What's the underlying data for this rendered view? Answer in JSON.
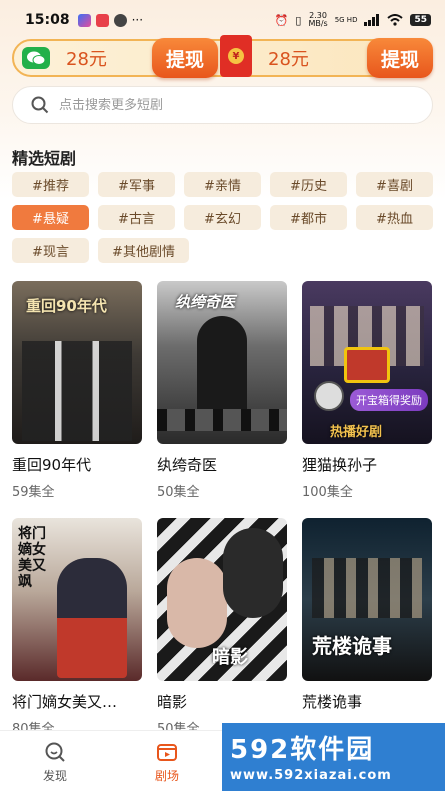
{
  "status_bar": {
    "time": "15:08",
    "speed_value": "2.30",
    "speed_unit": "MB/s",
    "network": "5G HD",
    "battery": "55"
  },
  "reward": {
    "left_amount": "28元",
    "right_amount": "28元",
    "withdraw_label": "提现",
    "redpacket_symbol": "¥"
  },
  "search": {
    "placeholder": "点击搜索更多短剧"
  },
  "section_title": "精选短剧",
  "tags": [
    "#推荐",
    "#军事",
    "#亲情",
    "#历史",
    "#喜剧",
    "#悬疑",
    "#古言",
    "#玄幻",
    "#都市",
    "#热血",
    "#现言",
    "#其他剧情"
  ],
  "active_tag_index": 5,
  "dramas": [
    {
      "title": "重回90年代",
      "episodes": "59集全",
      "poster_text": "重回90年代"
    },
    {
      "title": "纨绔奇医",
      "episodes": "50集全",
      "poster_text": "纨绔奇医"
    },
    {
      "title": "狸猫换孙子",
      "episodes": "100集全",
      "poster_text": "热播好剧",
      "badge": "开宝箱得奖励"
    },
    {
      "title": "将门嫡女美又…",
      "episodes": "80集全",
      "poster_text": "将门嫡女美又飒"
    },
    {
      "title": "暗影",
      "episodes": "50集全",
      "poster_text": "暗影"
    },
    {
      "title": "荒楼诡事",
      "episodes": "",
      "poster_text": "荒楼诡事"
    }
  ],
  "nav": {
    "discover": "发现",
    "theater": "剧场"
  },
  "watermark": {
    "big": "592软件园",
    "small": "www.592xiazai.com"
  },
  "colors": {
    "accent": "#f07a3e",
    "tag_bg": "#f6ecdd",
    "wechat": "#23b04a",
    "redpacket": "#e02e25"
  }
}
